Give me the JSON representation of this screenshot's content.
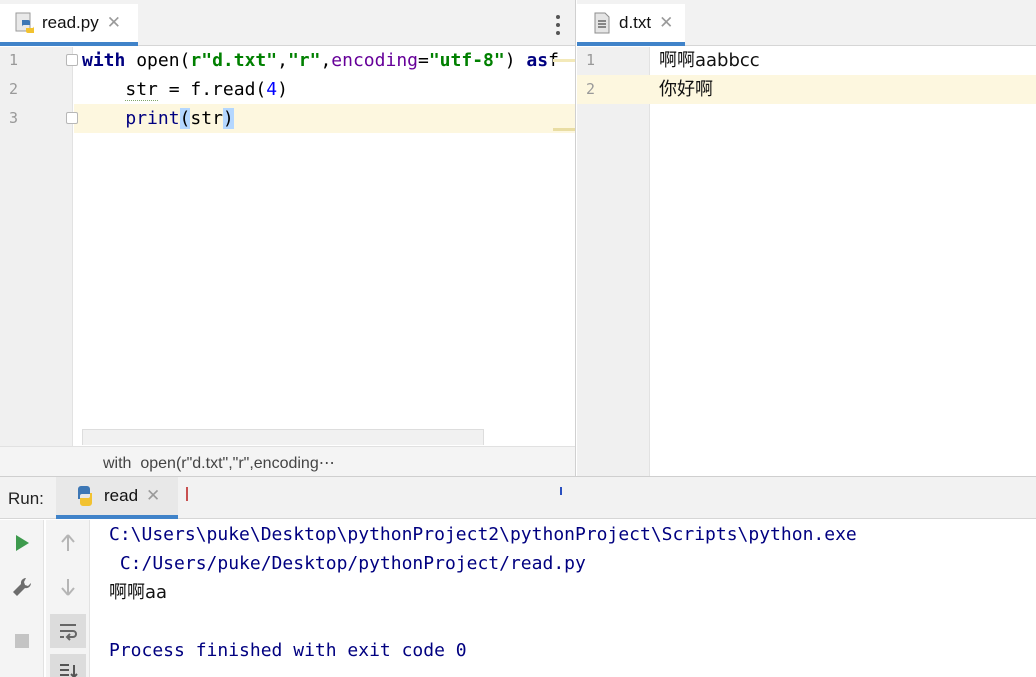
{
  "left_editor": {
    "tab": {
      "label": "read.py",
      "close": "✕",
      "icon": "python-file-icon"
    },
    "menu_icon": "more-vertical-icon",
    "line_numbers": [
      "1",
      "2",
      "3"
    ],
    "code": {
      "l1": {
        "kw_with": "with",
        "open_call": " open(",
        "raw_prefix": "r",
        "str_path": "\"d.txt\"",
        "comma1": ",",
        "str_mode": "\"r\"",
        "comma2": ",",
        "param_encoding": "encoding",
        "eq": "=",
        "str_enc": "\"utf-8\"",
        "close_paren": ")",
        "kw_as": " as",
        "truncated": "f"
      },
      "l2": {
        "indent": "    ",
        "var": "str",
        "assign": " = f.read(",
        "num": "4",
        "close": ")"
      },
      "l3": {
        "indent": "    ",
        "func": "print",
        "open_paren": "(",
        "arg": "str",
        "close_paren": ")"
      }
    },
    "breadcrumb": "with  open(r\"d.txt\",\"r\",encoding⋯"
  },
  "right_editor": {
    "tab": {
      "label": "d.txt",
      "close": "✕",
      "icon": "text-file-icon"
    },
    "line_numbers": [
      "1",
      "2"
    ],
    "lines": [
      "啊啊aabbcc",
      "你好啊"
    ]
  },
  "run_panel": {
    "title": "Run:",
    "tab": {
      "label": "read",
      "close": "✕",
      "icon": "python-icon"
    },
    "toolbar": {
      "left": [
        "run-icon",
        "wrench-icon",
        "stop-icon"
      ],
      "right": [
        "arrow-up-icon",
        "arrow-down-icon",
        "soft-wrap-icon",
        "scroll-to-end-icon"
      ]
    },
    "output": [
      "C:\\Users\\puke\\Desktop\\pythonProject2\\pythonProject\\Scripts\\python.exe",
      " C:/Users/puke/Desktop/pythonProject/read.py",
      "啊啊aa",
      "",
      "Process finished with exit code 0"
    ]
  },
  "colors": {
    "accent_tab": "#4083c9",
    "keyword": "#000080",
    "string": "#008000",
    "param": "#660099",
    "number": "#0000ff",
    "current_line": "#fdf7df",
    "run_green": "#3d9a4d"
  }
}
